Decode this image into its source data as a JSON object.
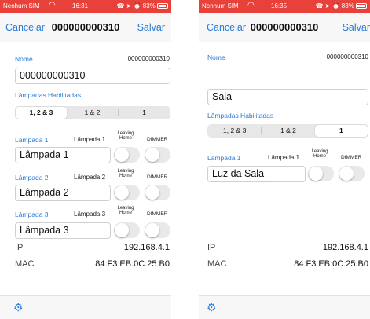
{
  "status": {
    "carrier": "Nenhum SIM",
    "left_time": "16:31",
    "right_time": "16:35",
    "battery": "83%"
  },
  "nav": {
    "cancel": "Cancelar",
    "save": "Salvar"
  },
  "labels": {
    "name": "Nome",
    "enabled_lamps": "Lâmpadas Habilitadas",
    "leaving_home_1": "Leaving",
    "leaving_home_2": "Home",
    "dimmer": "DIMMER",
    "ip": "IP",
    "mac": "MAC"
  },
  "segments": [
    "1, 2 & 3",
    "1 & 2",
    "1"
  ],
  "left": {
    "title": "000000000310",
    "device_id": "000000000310",
    "name_value": "000000000310",
    "selected_segment": "1, 2 & 3",
    "lamps": [
      {
        "label": "Lâmpada 1",
        "side_label": "Lâmpada 1",
        "value": "Lâmpada 1"
      },
      {
        "label": "Lâmpada 2",
        "side_label": "Lâmpada 2",
        "value": "Lâmpada 2"
      },
      {
        "label": "Lâmpada 3",
        "side_label": "Lâmpada 3",
        "value": "Lâmpada 3"
      }
    ],
    "ip": "192.168.4.1",
    "mac": "84:F3:EB:0C:25:B0"
  },
  "right": {
    "title": "000000000310",
    "device_id": "000000000310",
    "name_value": "Sala",
    "selected_segment": "1",
    "lamps": [
      {
        "label": "Lâmpada 1",
        "side_label": "Lâmpada 1",
        "value": "Luz da Sala"
      }
    ],
    "ip": "192.168.4.1",
    "mac": "84:F3:EB:0C:25:B0"
  },
  "icons": {
    "wifi": "wifi-icon",
    "gear": "gear-icon",
    "battery": "battery-icon"
  },
  "colors": {
    "status_bar": "#e8413a",
    "accent": "#2a7ad6"
  }
}
